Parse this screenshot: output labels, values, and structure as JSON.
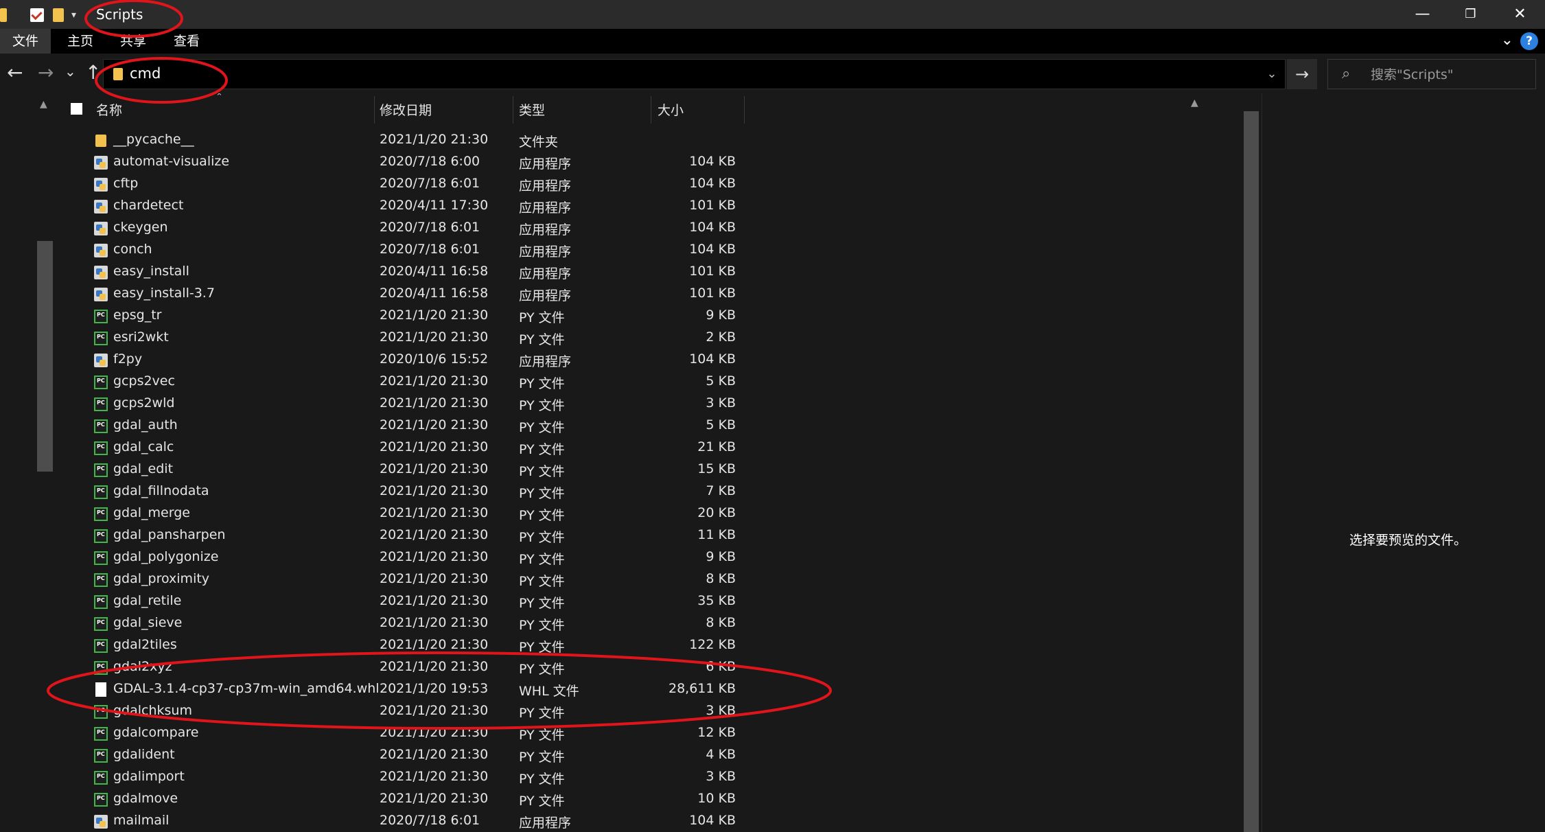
{
  "window": {
    "title": "Scripts",
    "controls": {
      "minimize": "—",
      "restore": "❐",
      "close": "✕"
    }
  },
  "ribbon": {
    "tabs": [
      "文件",
      "主页",
      "共享",
      "查看"
    ],
    "help": "?"
  },
  "address": {
    "path": "cmd",
    "search_placeholder": "搜索\"Scripts\""
  },
  "columns": {
    "name": "名称",
    "date": "修改日期",
    "type": "类型",
    "size": "大小"
  },
  "files": [
    {
      "name": "__pycache__",
      "date": "2021/1/20 21:30",
      "type": "文件夹",
      "size": "",
      "icon": "folder"
    },
    {
      "name": "automat-visualize",
      "date": "2020/7/18 6:00",
      "type": "应用程序",
      "size": "104 KB",
      "icon": "exe"
    },
    {
      "name": "cftp",
      "date": "2020/7/18 6:01",
      "type": "应用程序",
      "size": "104 KB",
      "icon": "exe"
    },
    {
      "name": "chardetect",
      "date": "2020/4/11 17:30",
      "type": "应用程序",
      "size": "101 KB",
      "icon": "exe"
    },
    {
      "name": "ckeygen",
      "date": "2020/7/18 6:01",
      "type": "应用程序",
      "size": "104 KB",
      "icon": "exe"
    },
    {
      "name": "conch",
      "date": "2020/7/18 6:01",
      "type": "应用程序",
      "size": "104 KB",
      "icon": "exe"
    },
    {
      "name": "easy_install",
      "date": "2020/4/11 16:58",
      "type": "应用程序",
      "size": "101 KB",
      "icon": "exe"
    },
    {
      "name": "easy_install-3.7",
      "date": "2020/4/11 16:58",
      "type": "应用程序",
      "size": "101 KB",
      "icon": "exe"
    },
    {
      "name": "epsg_tr",
      "date": "2021/1/20 21:30",
      "type": "PY 文件",
      "size": "9 KB",
      "icon": "py"
    },
    {
      "name": "esri2wkt",
      "date": "2021/1/20 21:30",
      "type": "PY 文件",
      "size": "2 KB",
      "icon": "py"
    },
    {
      "name": "f2py",
      "date": "2020/10/6 15:52",
      "type": "应用程序",
      "size": "104 KB",
      "icon": "exe"
    },
    {
      "name": "gcps2vec",
      "date": "2021/1/20 21:30",
      "type": "PY 文件",
      "size": "5 KB",
      "icon": "py"
    },
    {
      "name": "gcps2wld",
      "date": "2021/1/20 21:30",
      "type": "PY 文件",
      "size": "3 KB",
      "icon": "py"
    },
    {
      "name": "gdal_auth",
      "date": "2021/1/20 21:30",
      "type": "PY 文件",
      "size": "5 KB",
      "icon": "py"
    },
    {
      "name": "gdal_calc",
      "date": "2021/1/20 21:30",
      "type": "PY 文件",
      "size": "21 KB",
      "icon": "py"
    },
    {
      "name": "gdal_edit",
      "date": "2021/1/20 21:30",
      "type": "PY 文件",
      "size": "15 KB",
      "icon": "py"
    },
    {
      "name": "gdal_fillnodata",
      "date": "2021/1/20 21:30",
      "type": "PY 文件",
      "size": "7 KB",
      "icon": "py"
    },
    {
      "name": "gdal_merge",
      "date": "2021/1/20 21:30",
      "type": "PY 文件",
      "size": "20 KB",
      "icon": "py"
    },
    {
      "name": "gdal_pansharpen",
      "date": "2021/1/20 21:30",
      "type": "PY 文件",
      "size": "11 KB",
      "icon": "py"
    },
    {
      "name": "gdal_polygonize",
      "date": "2021/1/20 21:30",
      "type": "PY 文件",
      "size": "9 KB",
      "icon": "py"
    },
    {
      "name": "gdal_proximity",
      "date": "2021/1/20 21:30",
      "type": "PY 文件",
      "size": "8 KB",
      "icon": "py"
    },
    {
      "name": "gdal_retile",
      "date": "2021/1/20 21:30",
      "type": "PY 文件",
      "size": "35 KB",
      "icon": "py"
    },
    {
      "name": "gdal_sieve",
      "date": "2021/1/20 21:30",
      "type": "PY 文件",
      "size": "8 KB",
      "icon": "py"
    },
    {
      "name": "gdal2tiles",
      "date": "2021/1/20 21:30",
      "type": "PY 文件",
      "size": "122 KB",
      "icon": "py"
    },
    {
      "name": "gdal2xyz",
      "date": "2021/1/20 21:30",
      "type": "PY 文件",
      "size": "6 KB",
      "icon": "py"
    },
    {
      "name": "GDAL-3.1.4-cp37-cp37m-win_amd64.whl",
      "date": "2021/1/20 19:53",
      "type": "WHL 文件",
      "size": "28,611 KB",
      "icon": "whl"
    },
    {
      "name": "gdalchksum",
      "date": "2021/1/20 21:30",
      "type": "PY 文件",
      "size": "3 KB",
      "icon": "py"
    },
    {
      "name": "gdalcompare",
      "date": "2021/1/20 21:30",
      "type": "PY 文件",
      "size": "12 KB",
      "icon": "py"
    },
    {
      "name": "gdalident",
      "date": "2021/1/20 21:30",
      "type": "PY 文件",
      "size": "4 KB",
      "icon": "py"
    },
    {
      "name": "gdalimport",
      "date": "2021/1/20 21:30",
      "type": "PY 文件",
      "size": "3 KB",
      "icon": "py"
    },
    {
      "name": "gdalmove",
      "date": "2021/1/20 21:30",
      "type": "PY 文件",
      "size": "10 KB",
      "icon": "py"
    },
    {
      "name": "mailmail",
      "date": "2020/7/18 6:01",
      "type": "应用程序",
      "size": "104 KB",
      "icon": "exe"
    }
  ],
  "preview": {
    "empty_text": "选择要预览的文件。"
  },
  "colors": {
    "background": "#191919",
    "titlebar": "#2b2b2b",
    "ribbon": "#000000",
    "annotation_red": "#e0151b",
    "folder_yellow": "#f2c14e",
    "help_blue": "#2b80e0"
  }
}
